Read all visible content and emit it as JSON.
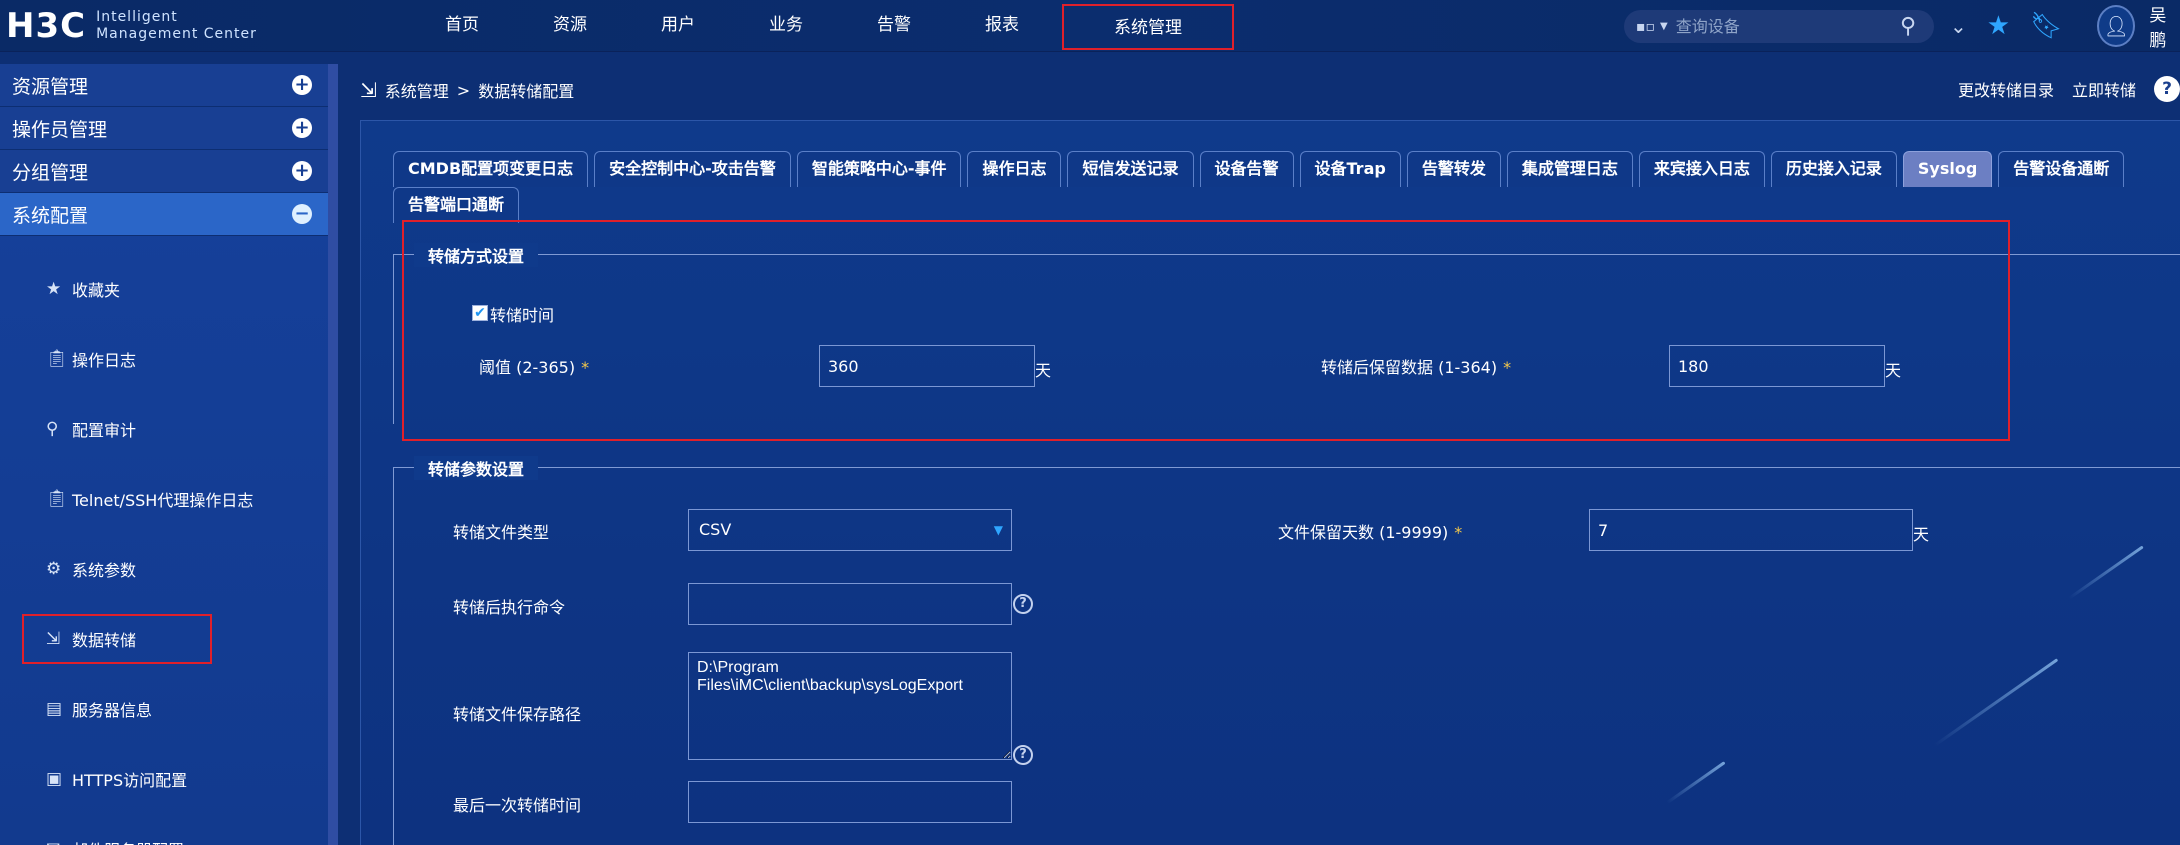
{
  "header": {
    "logo_mark": "H3C",
    "logo_line1": "Intelligent",
    "logo_line2": "Management Center",
    "nav": [
      "首页",
      "资源",
      "用户",
      "业务",
      "告警",
      "报表"
    ],
    "nav_active": "系统管理",
    "search_placeholder": "查询设备",
    "username": "吴鹏"
  },
  "sidebar": {
    "groups": [
      {
        "label": "资源管理",
        "toggle": "+"
      },
      {
        "label": "操作员管理",
        "toggle": "+"
      },
      {
        "label": "分组管理",
        "toggle": "+"
      },
      {
        "label": "系统配置",
        "toggle": "−"
      }
    ],
    "items": [
      {
        "label": "收藏夹",
        "icon": "star-icon"
      },
      {
        "label": "操作日志",
        "icon": "clipboard-icon"
      },
      {
        "label": "配置审计",
        "icon": "audit-icon"
      },
      {
        "label": "Telnet/SSH代理操作日志",
        "icon": "clipboard-icon"
      },
      {
        "label": "系统参数",
        "icon": "gear-icon"
      },
      {
        "label": "数据转储",
        "icon": "export-icon"
      },
      {
        "label": "服务器信息",
        "icon": "server-icon"
      },
      {
        "label": "HTTPS访问配置",
        "icon": "https-icon"
      },
      {
        "label": "邮件服务器配置",
        "icon": "mail-icon"
      }
    ]
  },
  "breadcrumb": {
    "parent": "系统管理",
    "separator": ">",
    "current": "数据转储配置",
    "actions": [
      "更改转储目录",
      "立即转储"
    ]
  },
  "tabs": {
    "row1": [
      "CMDB配置项变更日志",
      "安全控制中心-攻击告警",
      "智能策略中心-事件",
      "操作日志",
      "短信发送记录",
      "设备告警",
      "设备Trap",
      "告警转发",
      "集成管理日志",
      "来宾接入日志",
      "历史接入记录",
      "Syslog",
      "告警设备通断"
    ],
    "row2": [
      "告警端口通断"
    ],
    "selected": "Syslog"
  },
  "dump_mode": {
    "legend": "转储方式设置",
    "checkbox_label": "转储时间",
    "checkbox_checked": true,
    "threshold_label": "阈值 (2-365)",
    "threshold_value": "360",
    "threshold_unit": "天",
    "retain_label": "转储后保留数据 (1-364)",
    "retain_value": "180",
    "retain_unit": "天",
    "required_mark": "*"
  },
  "dump_params": {
    "legend": "转储参数设置",
    "file_type_label": "转储文件类型",
    "file_type_value": "CSV",
    "keep_days_label": "文件保留天数 (1-9999)",
    "keep_days_value": "7",
    "keep_days_unit": "天",
    "post_cmd_label": "转储后执行命令",
    "post_cmd_value": "",
    "path_label": "转储文件保存路径",
    "path_value": "D:\\Program Files\\iMC\\client\\backup\\sysLogExport",
    "last_time_label": "最后一次转储时间",
    "last_time_value": ""
  }
}
